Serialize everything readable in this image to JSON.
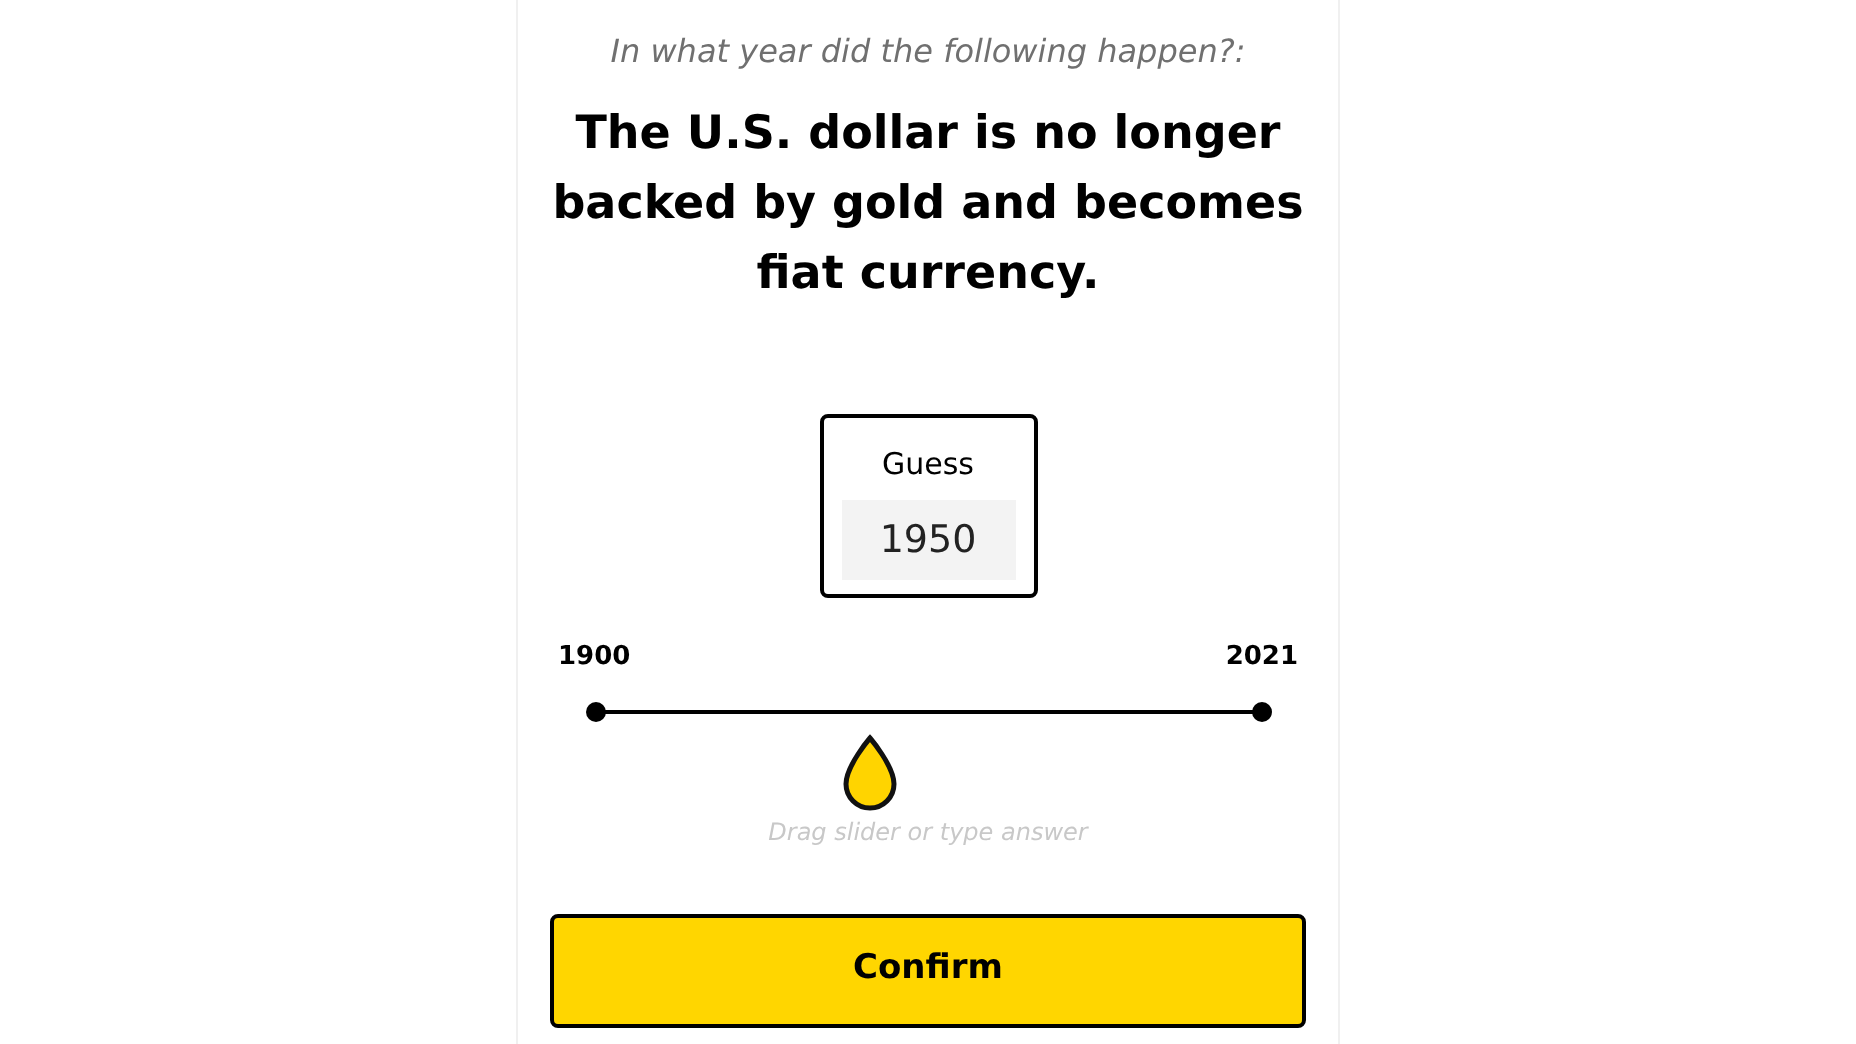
{
  "prompt": "In what year did the following happen?:",
  "question": "The U.S. dollar is no longer backed by gold and becomes fiat currency.",
  "guess": {
    "label": "Guess",
    "value": "1950"
  },
  "slider": {
    "min_label": "1900",
    "max_label": "2021",
    "level": 0.413,
    "hint": "Drag slider or type answer"
  },
  "confirm_button": "Confirm"
}
